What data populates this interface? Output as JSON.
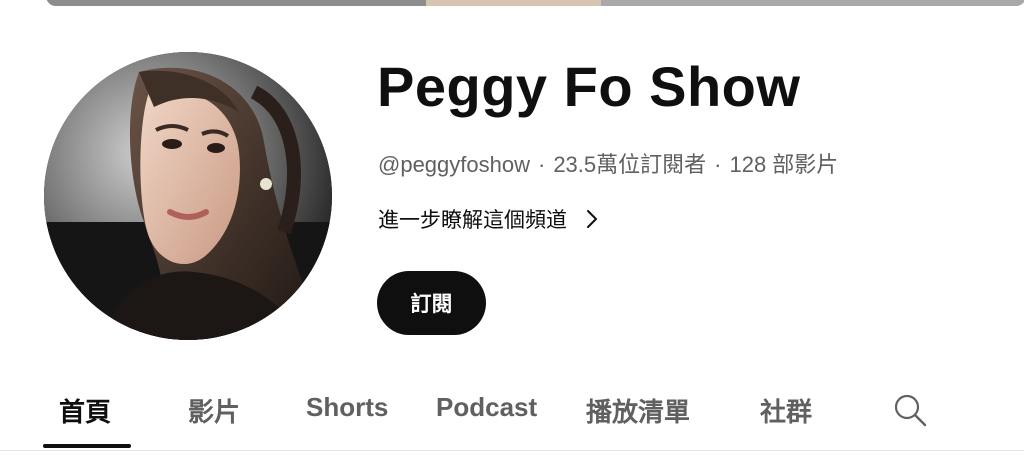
{
  "channel": {
    "title": "Peggy Fo Show",
    "handle": "@peggyfoshow",
    "separator": "·",
    "subscribers": "23.5萬位訂閱者",
    "videos": "128 部影片",
    "more_label": "進一步瞭解這個頻道",
    "subscribe_label": "訂閱"
  },
  "tabs": [
    {
      "label": "首頁",
      "active": true
    },
    {
      "label": "影片",
      "active": false
    },
    {
      "label": "Shorts",
      "active": false
    },
    {
      "label": "Podcast",
      "active": false
    },
    {
      "label": "播放清單",
      "active": false
    },
    {
      "label": "社群",
      "active": false
    }
  ],
  "icons": {
    "more_chevron": "chevron-right-icon",
    "search": "search-icon"
  },
  "colors": {
    "primary_text": "#0f0f0f",
    "secondary_text": "#606060",
    "subscribe_bg": "#0f0f0f",
    "subscribe_text": "#ffffff"
  }
}
